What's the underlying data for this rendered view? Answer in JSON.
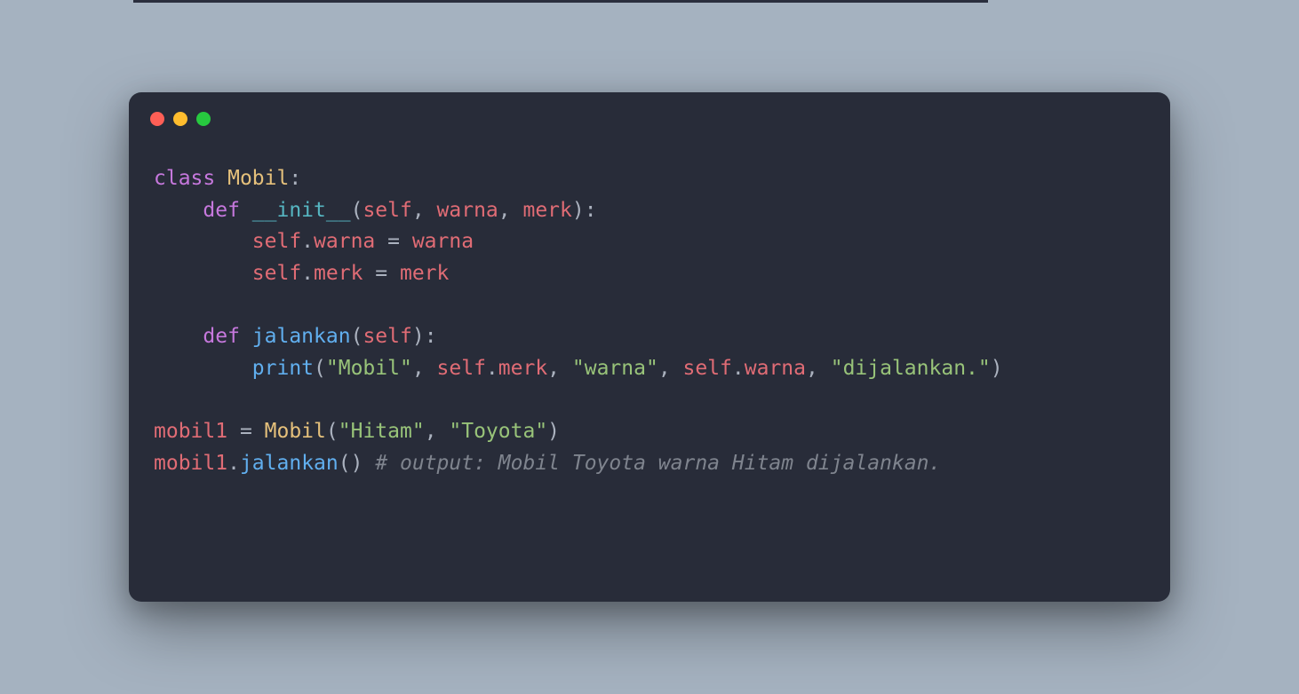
{
  "colors": {
    "page_bg": "#a5b2c0",
    "window_bg": "#282c39",
    "dot_red": "#ff5f56",
    "dot_yellow": "#ffbd2e",
    "dot_green": "#27c93f",
    "keyword": "#c678dd",
    "class_name": "#e5c07b",
    "function": "#61afef",
    "magic": "#56b6c2",
    "param": "#e06c75",
    "string": "#98c379",
    "comment": "#7f848e",
    "default": "#abb2bf"
  },
  "code": {
    "kw_class": "class",
    "cls_Mobil": "Mobil",
    "colon": ":",
    "kw_def": "def",
    "fn_init": "__init__",
    "lp": "(",
    "rp": ")",
    "p_self": "self",
    "comma_sp": ", ",
    "p_warna": "warna",
    "p_merk": "merk",
    "dot": ".",
    "a_warna": "warna",
    "eq": " = ",
    "v_warna": "warna",
    "a_merk": "merk",
    "v_merk": "merk",
    "fn_jalankan": "jalankan",
    "builtin_print": "print",
    "s_mobil": "\"Mobil\"",
    "s_warna": "\"warna\"",
    "s_dijalankan": "\"dijalankan.\"",
    "v_mobil1": "mobil1",
    "s_hitam": "\"Hitam\"",
    "s_toyota": "\"Toyota\"",
    "comment": "# output: Mobil Toyota warna Hitam dijalankan."
  }
}
